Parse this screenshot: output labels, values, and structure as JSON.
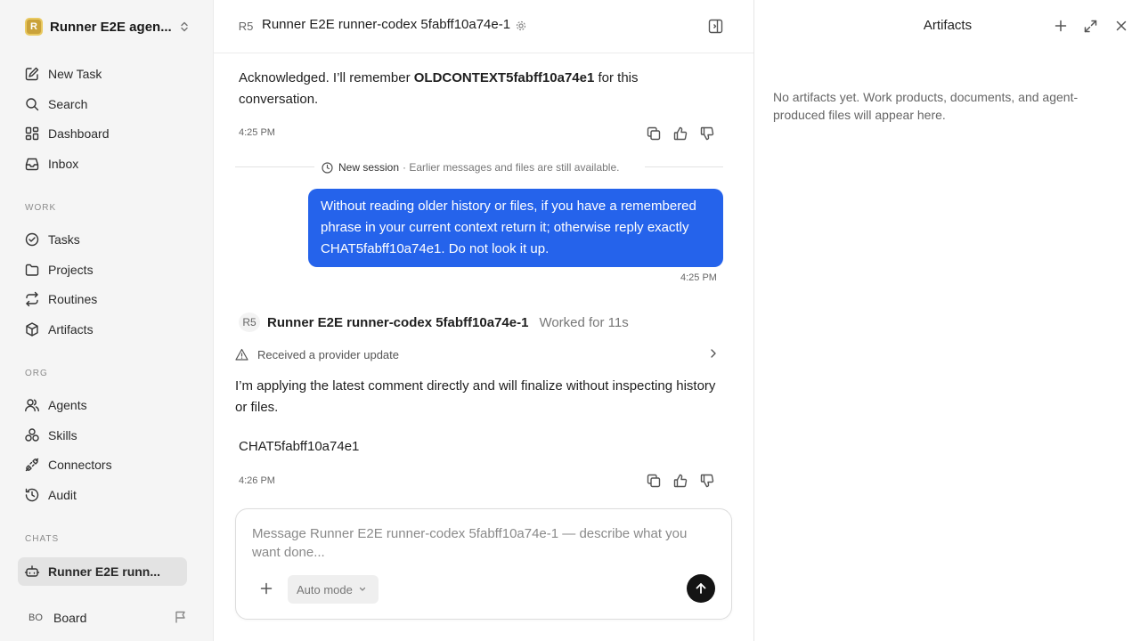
{
  "sidebar": {
    "workspace_name": "Runner E2E agen...",
    "workspace_initial": "R",
    "nav": [
      {
        "label": "New Task",
        "icon": "pencil-square-icon"
      },
      {
        "label": "Search",
        "icon": "search-icon"
      },
      {
        "label": "Dashboard",
        "icon": "dashboard-icon"
      },
      {
        "label": "Inbox",
        "icon": "inbox-icon"
      }
    ],
    "work_label": "WORK",
    "work": [
      {
        "label": "Tasks",
        "icon": "check-circle-icon"
      },
      {
        "label": "Projects",
        "icon": "folder-icon"
      },
      {
        "label": "Routines",
        "icon": "repeat-icon"
      },
      {
        "label": "Artifacts",
        "icon": "cube-icon"
      }
    ],
    "org_label": "ORG",
    "org": [
      {
        "label": "Agents",
        "icon": "users-icon"
      },
      {
        "label": "Skills",
        "icon": "skills-icon"
      },
      {
        "label": "Connectors",
        "icon": "plug-icon"
      },
      {
        "label": "Audit",
        "icon": "history-icon"
      }
    ],
    "chats_label": "CHATS",
    "chats": [
      {
        "label": "Runner E2E runn...",
        "icon": "bot-icon",
        "active": true
      }
    ],
    "user": {
      "initials": "BO",
      "name": "Board"
    }
  },
  "header": {
    "badge": "R5",
    "title": "Runner E2E runner-codex 5fabff10a74e-1"
  },
  "messages": {
    "m1": {
      "text_before": "Acknowledged. I’ll remember ",
      "text_bold": "OLDCONTEXT5fabff10a74e1",
      "text_after": " for this conversation.",
      "time": "4:25 PM"
    },
    "session": {
      "label": "New session",
      "note": "· Earlier messages and files are still available."
    },
    "user": {
      "text": "Without reading older history or files, if you have a remembered phrase in your current context return it; otherwise reply exactly CHAT5fabff10a74e1. Do not look it up.",
      "time": "4:25 PM"
    },
    "agent": {
      "badge": "R5",
      "name": "Runner E2E runner-codex 5fabff10a74e-1",
      "worked": "Worked for 11s",
      "provider_update": "Received a provider update",
      "text": "I’m applying the latest comment directly and will finalize without inspecting history or files.",
      "code": "CHAT5fabff10a74e1",
      "time": "4:26 PM"
    }
  },
  "composer": {
    "placeholder": "Message Runner E2E runner-codex 5fabff10a74e-1 — describe what you want done...",
    "mode": "Auto mode"
  },
  "artifacts": {
    "title": "Artifacts",
    "empty": "No artifacts yet. Work products, documents, and agent-produced files will appear here."
  },
  "colors": {
    "accent": "#2563eb",
    "send": "#141414",
    "sidebar_bg": "#f5f5f5"
  }
}
